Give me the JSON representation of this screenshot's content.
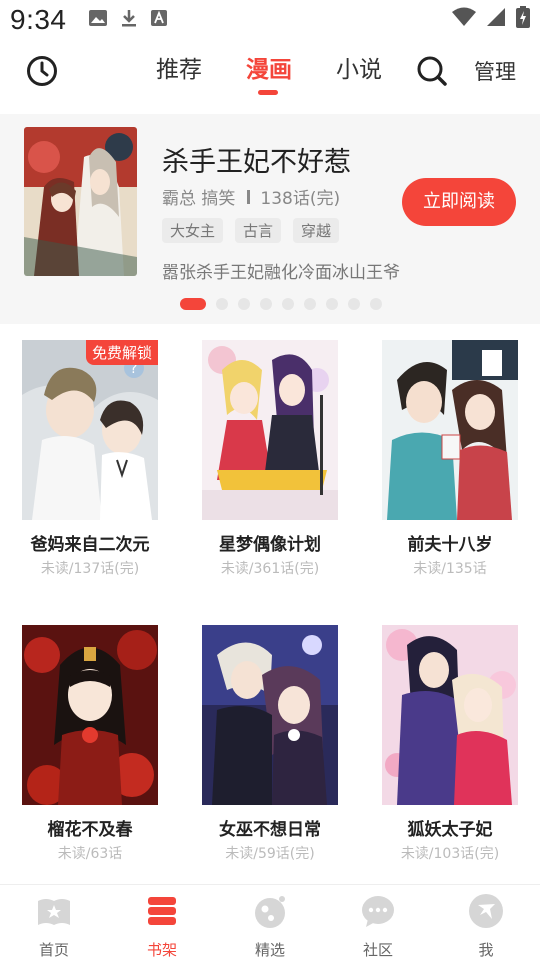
{
  "status_bar": {
    "time": "9:34",
    "icons": [
      "image-icon",
      "download-icon",
      "text-icon",
      "wifi-icon",
      "signal-icon",
      "battery-charging-icon"
    ]
  },
  "top_nav": {
    "tabs": [
      {
        "label": "推荐",
        "active": false
      },
      {
        "label": "漫画",
        "active": true
      },
      {
        "label": "小说",
        "active": false
      }
    ],
    "manage_label": "管理"
  },
  "featured": {
    "title": "杀手王妃不好惹",
    "genres": "霸总 搞笑",
    "chapters": "138话(完)",
    "tags": [
      "大女主",
      "古言",
      "穿越"
    ],
    "read_button": "立即阅读",
    "description": "嚣张杀手王妃融化冷面冰山王爷",
    "carousel_count": 9,
    "carousel_active": 0
  },
  "comics": [
    {
      "title": "爸妈来自二次元",
      "progress": "未读/137话(完)",
      "badge": "免费解锁"
    },
    {
      "title": "星梦偶像计划",
      "progress": "未读/361话(完)",
      "badge": ""
    },
    {
      "title": "前夫十八岁",
      "progress": "未读/135话",
      "badge": ""
    },
    {
      "title": "榴花不及春",
      "progress": "未读/63话",
      "badge": ""
    },
    {
      "title": "女巫不想日常",
      "progress": "未读/59话(完)",
      "badge": ""
    },
    {
      "title": "狐妖太子妃",
      "progress": "未读/103话(完)",
      "badge": ""
    }
  ],
  "bottom_nav": [
    {
      "label": "首页",
      "icon": "home-book-icon",
      "active": false
    },
    {
      "label": "书架",
      "icon": "bookshelf-icon",
      "active": true
    },
    {
      "label": "精选",
      "icon": "featured-icon",
      "active": false
    },
    {
      "label": "社区",
      "icon": "chat-bubble-icon",
      "active": false
    },
    {
      "label": "我",
      "icon": "profile-icon",
      "active": false
    }
  ],
  "colors": {
    "accent": "#f4453a",
    "inactive_icon": "#d6d6d6"
  }
}
